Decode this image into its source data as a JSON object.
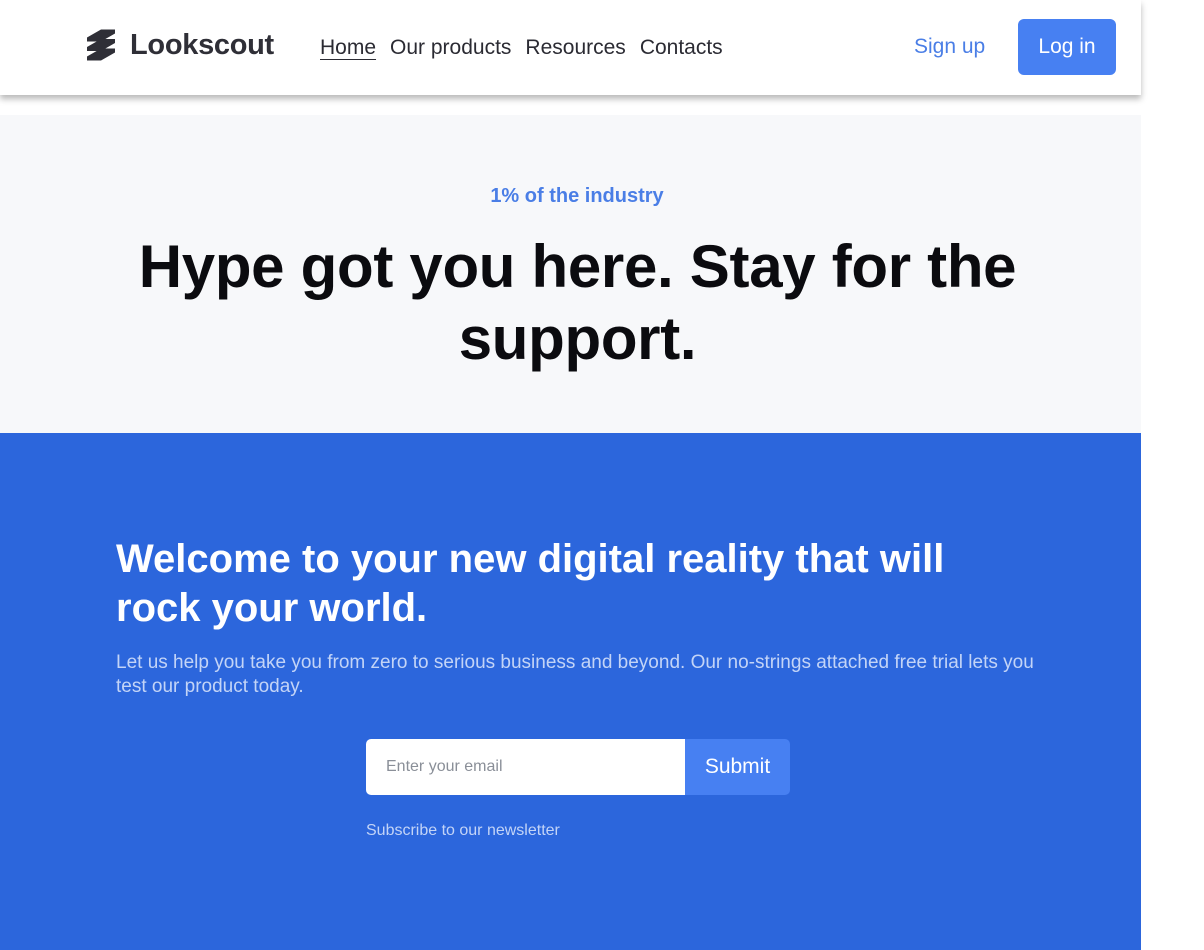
{
  "header": {
    "brand": "Lookscout",
    "logo_icon": "lookscout-logo-icon",
    "nav": [
      "Home",
      "Our products",
      "Resources",
      "Contacts"
    ],
    "active_nav": "Home",
    "signup_label": "Sign up",
    "login_label": "Log in"
  },
  "hero": {
    "eyebrow": "1% of the industry",
    "title": "Hype got you here. Stay for the support."
  },
  "cta": {
    "title": "Welcome to your new digital reality that will rock your world.",
    "text": "Let us help you take you from zero to serious business and beyond. Our no-strings attached free trial lets you test our product today.",
    "email_placeholder": "Enter your email",
    "submit_label": "Submit",
    "note": "Subscribe to our newsletter"
  },
  "colors": {
    "accent": "#4780f2",
    "section_blue": "#2c66dc",
    "hero_bg": "#f7f8fa",
    "link_blue": "#4a7ee6",
    "logo_dark": "#2f2f37"
  }
}
